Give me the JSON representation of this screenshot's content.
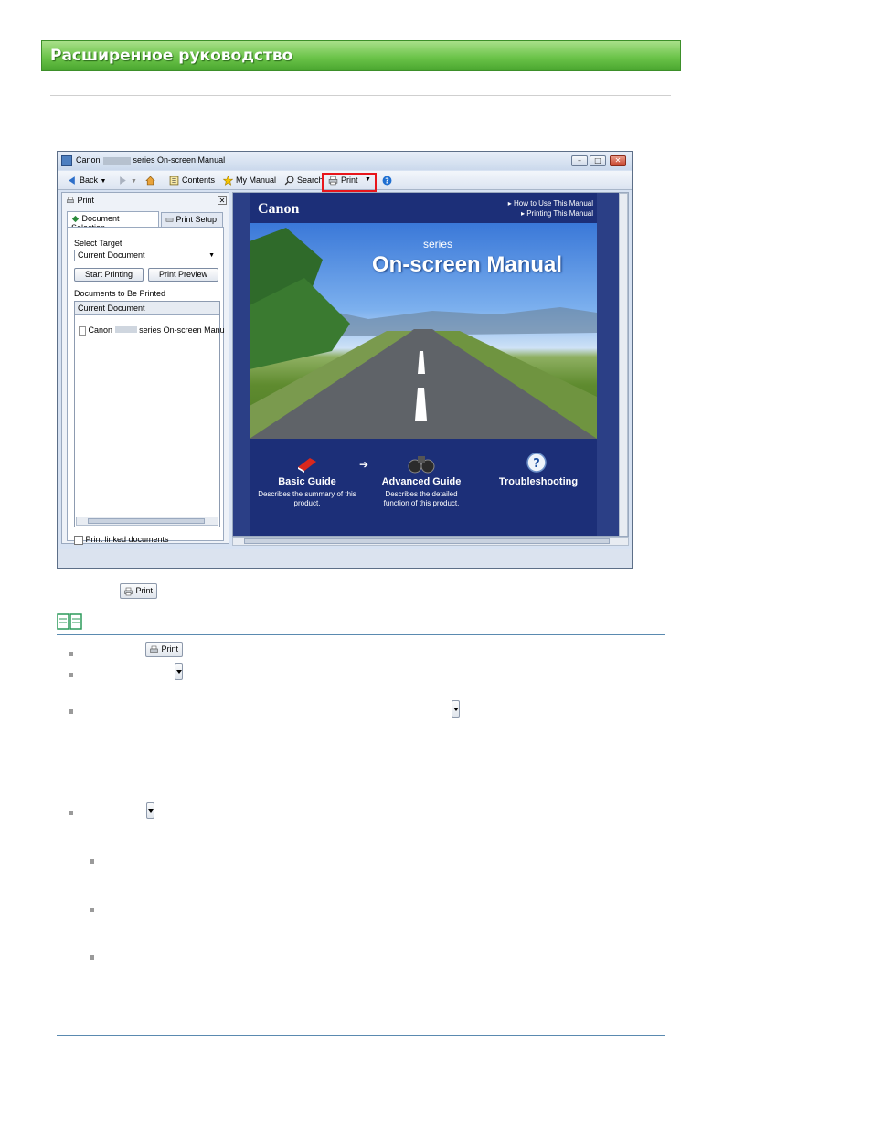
{
  "header": {
    "title": "Расширенное руководство"
  },
  "window": {
    "title_prefix": "Canon",
    "title_suffix": "series On-screen Manual",
    "toolbar": {
      "back": "Back",
      "contents": "Contents",
      "my_manual": "My Manual",
      "search": "Search",
      "print": "Print"
    },
    "left_pane": {
      "title": "Print",
      "tab_document_selection": "Document Selection",
      "tab_print_setup": "Print Setup",
      "select_target_label": "Select Target",
      "select_target_value": "Current Document",
      "start_printing": "Start Printing",
      "print_preview": "Print Preview",
      "documents_label": "Documents to Be Printed",
      "list_header": "Current Document",
      "doc_prefix": "Canon",
      "doc_suffix": "series On-screen Manu",
      "print_linked": "Print linked documents"
    },
    "content": {
      "logo": "Canon",
      "link_how_to_use": "How to Use This Manual",
      "link_printing": "Printing This Manual",
      "series": "series",
      "manual_title": "On-screen Manual",
      "guides": [
        {
          "title": "Basic Guide",
          "desc": "Describes the summary of this product."
        },
        {
          "title": "Advanced Guide",
          "desc": "Describes the detailed function of this product."
        },
        {
          "title": "Troubleshooting",
          "desc": ""
        }
      ]
    }
  },
  "inline": {
    "print_button": "Print"
  },
  "colors": {
    "header_green": "#6cc44a",
    "highlight_red": "#e8161c",
    "content_blue": "#1c2f78"
  }
}
